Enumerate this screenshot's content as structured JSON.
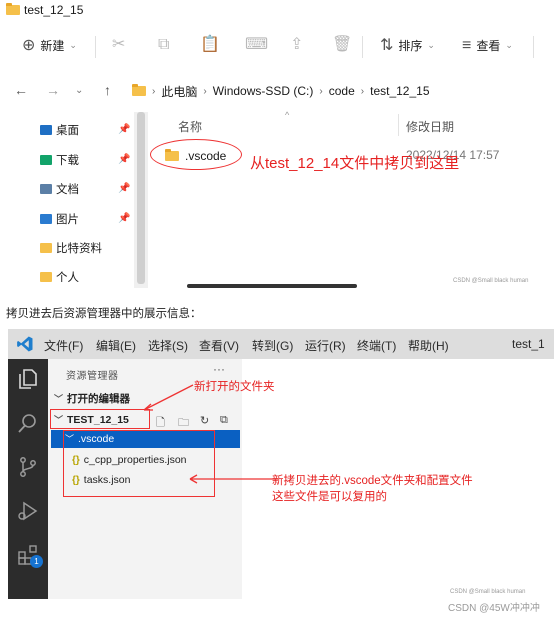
{
  "explorer": {
    "title": "test_12_15",
    "toolbar": {
      "new_label": "新建",
      "sort_label": "排序",
      "view_label": "查看"
    },
    "breadcrumb": [
      "此电脑",
      "Windows-SSD (C:)",
      "code",
      "test_12_15"
    ],
    "quick_access": [
      {
        "label": "桌面",
        "icon": "desktop-icon",
        "color": "#1f6fc4",
        "pinned": true
      },
      {
        "label": "下载",
        "icon": "download-icon",
        "color": "#12a36a",
        "pinned": true
      },
      {
        "label": "文档",
        "icon": "documents-icon",
        "color": "#5b7fa6",
        "pinned": true
      },
      {
        "label": "图片",
        "icon": "pictures-icon",
        "color": "#2a7bd0",
        "pinned": true
      },
      {
        "label": "比特资料",
        "icon": "folder-icon",
        "color": "#f5c04a",
        "pinned": false
      },
      {
        "label": "个人",
        "icon": "folder-icon",
        "color": "#f5c04a",
        "pinned": false
      }
    ],
    "columns": {
      "name": "名称",
      "modified": "修改日期"
    },
    "files": [
      {
        "name": ".vscode",
        "modified": "2022/12/14 17:57"
      }
    ],
    "annotation": "从test_12_14文件中拷贝到这里",
    "watermark": "CSDN @Small black human"
  },
  "caption": "拷贝进去后资源管理器中的展示信息：",
  "vscode": {
    "menu": [
      "文件(F)",
      "编辑(E)",
      "选择(S)",
      "查看(V)",
      "转到(G)",
      "运行(R)",
      "终端(T)",
      "帮助(H)"
    ],
    "title_partial": "test_1",
    "sidebar_title": "资源管理器",
    "more": "···",
    "open_editors": "打开的编辑器",
    "folder": "TEST_12_15",
    "tree": [
      {
        "label": ".vscode",
        "type": "folder",
        "selected": true
      },
      {
        "label": "c_cpp_properties.json",
        "type": "json"
      },
      {
        "label": "tasks.json",
        "type": "json"
      }
    ],
    "badge_count": "1",
    "annotation_folder": "新打开的文件夹",
    "annotation_files_line1": "新拷贝进去的.vscode文件夹和配置文件",
    "annotation_files_line2": "这些文件是可以复用的",
    "watermark": "CSDN @Small black human"
  },
  "footer_watermark": "CSDN @45W冲冲冲",
  "colors": {
    "accent_red": "#e62222",
    "selection_blue": "#0a60c2",
    "activity_bar": "#2c2c2c"
  }
}
